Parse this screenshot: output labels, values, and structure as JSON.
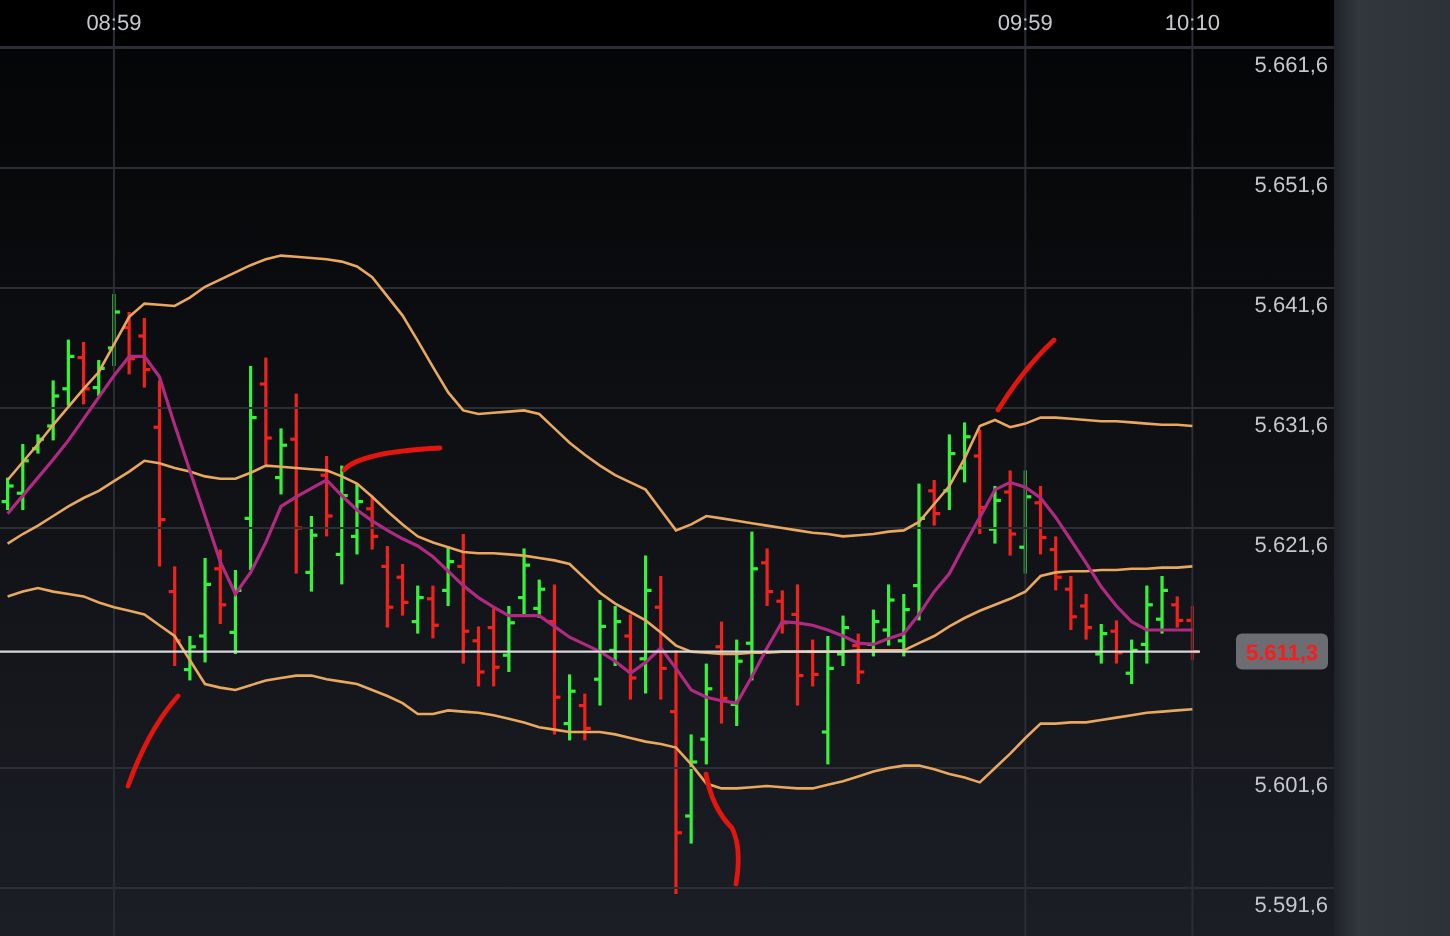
{
  "chart": {
    "chart_data": {
      "type": "line",
      "grid": true,
      "ref_lines": [
        {
          "axis": "y",
          "value": 5611.3,
          "label": "5.611,3"
        }
      ],
      "categories": [
        null,
        null,
        null,
        null,
        null,
        null,
        null,
        "08:59",
        null,
        null,
        null,
        null,
        null,
        null,
        null,
        null,
        null,
        null,
        null,
        null,
        null,
        null,
        null,
        null,
        null,
        null,
        null,
        null,
        null,
        null,
        null,
        null,
        null,
        null,
        null,
        null,
        null,
        null,
        null,
        null,
        null,
        null,
        null,
        null,
        null,
        null,
        null,
        null,
        null,
        null,
        null,
        null,
        null,
        null,
        null,
        null,
        null,
        null,
        null,
        null,
        null,
        null,
        null,
        null,
        null,
        null,
        null,
        "09:59",
        null,
        null,
        null,
        null,
        null,
        null,
        null,
        null,
        null,
        null,
        "10:10"
      ],
      "ylim": [
        5587.6,
        5661.6
      ],
      "yticks": [
        {
          "value": 5661.6,
          "label": "5.661,6"
        },
        {
          "value": 5651.6,
          "label": "5.651,6"
        },
        {
          "value": 5641.6,
          "label": "5.641,6"
        },
        {
          "value": 5631.6,
          "label": "5.631,6"
        },
        {
          "value": 5621.6,
          "label": "5.621,6"
        },
        {
          "value": 5601.6,
          "label": "5.601,6"
        },
        {
          "value": 5591.6,
          "label": "5.591,6"
        }
      ],
      "series": [
        {
          "color": "#e9a85e",
          "values": [
            5625.6,
            5627.1,
            5628.6,
            5630.2,
            5631.7,
            5633.2,
            5634.6,
            5636.9,
            5639.2,
            5640.3,
            5640.2,
            5640.1,
            5640.8,
            5641.7,
            5642.3,
            5642.9,
            5643.5,
            5644.0,
            5644.3,
            5644.2,
            5644.1,
            5644.0,
            5643.8,
            5643.4,
            5642.5,
            5640.9,
            5639.3,
            5637.2,
            5635.0,
            5632.9,
            5631.4,
            5631.1,
            5631.2,
            5631.3,
            5631.4,
            5631.1,
            5629.9,
            5628.7,
            5627.7,
            5626.8,
            5626.0,
            5625.4,
            5624.8,
            5623.1,
            5621.4,
            5621.9,
            5622.6,
            5622.4,
            5622.2,
            5622.0,
            5621.8,
            5621.6,
            5621.4,
            5621.2,
            5621.1,
            5620.9,
            5621.0,
            5621.1,
            5621.3,
            5621.4,
            5622.1,
            5623.6,
            5625.1,
            5627.4,
            5630.1,
            5630.6,
            5630.0,
            5630.3,
            5630.8,
            5630.8,
            5630.7,
            5630.6,
            5630.5,
            5630.5,
            5630.4,
            5630.3,
            5630.2,
            5630.2,
            5630.1
          ]
        },
        {
          "color": "#e9a85e",
          "values": [
            5620.3,
            5621.1,
            5621.8,
            5622.6,
            5623.4,
            5624.1,
            5624.7,
            5625.5,
            5626.3,
            5627.2,
            5627.0,
            5626.6,
            5626.3,
            5625.9,
            5625.7,
            5625.7,
            5626.2,
            5626.8,
            5626.7,
            5626.6,
            5626.5,
            5626.4,
            5625.9,
            5625.3,
            5624.2,
            5623.0,
            5621.9,
            5620.9,
            5620.4,
            5620.0,
            5619.6,
            5619.5,
            5619.5,
            5619.4,
            5619.3,
            5619.1,
            5618.9,
            5618.6,
            5617.4,
            5616.2,
            5615.3,
            5614.6,
            5613.9,
            5612.9,
            5611.8,
            5611.3,
            5611.2,
            5611.1,
            5611.1,
            5611.2,
            5611.2,
            5611.3,
            5611.3,
            5611.3,
            5611.3,
            5611.3,
            5611.4,
            5611.4,
            5611.4,
            5611.4,
            5612.0,
            5612.6,
            5613.4,
            5614.1,
            5614.7,
            5615.2,
            5615.7,
            5616.3,
            5617.6,
            5617.9,
            5618.0,
            5618.0,
            5618.1,
            5618.1,
            5618.2,
            5618.2,
            5618.3,
            5618.3,
            5618.4
          ]
        },
        {
          "color": "#e9a85e",
          "values": [
            5615.9,
            5616.3,
            5616.6,
            5616.3,
            5616.1,
            5615.9,
            5615.4,
            5615.0,
            5614.7,
            5614.4,
            5613.5,
            5612.6,
            5610.6,
            5608.6,
            5608.3,
            5608.1,
            5608.5,
            5608.9,
            5609.1,
            5609.3,
            5609.3,
            5609.0,
            5608.8,
            5608.6,
            5608.1,
            5607.6,
            5607.0,
            5606.1,
            5606.1,
            5606.4,
            5606.3,
            5606.2,
            5606.0,
            5605.7,
            5605.4,
            5605.0,
            5604.8,
            5604.6,
            5604.6,
            5604.6,
            5604.4,
            5604.1,
            5603.8,
            5603.6,
            5603.3,
            5601.9,
            5600.3,
            5599.9,
            5599.9,
            5600.0,
            5600.1,
            5600.0,
            5599.9,
            5599.9,
            5600.2,
            5600.5,
            5600.9,
            5601.3,
            5601.6,
            5601.8,
            5601.8,
            5601.5,
            5601.1,
            5600.8,
            5600.4,
            5601.6,
            5602.8,
            5604.1,
            5605.3,
            5605.3,
            5605.4,
            5605.4,
            5605.6,
            5605.8,
            5606.0,
            5606.2,
            5606.3,
            5606.4,
            5606.5
          ]
        },
        {
          "color": "#b02a82",
          "values": [
            5622.8,
            5624.3,
            5625.8,
            5627.3,
            5628.9,
            5630.7,
            5632.5,
            5634.3,
            5635.9,
            5635.9,
            5634.2,
            5630.2,
            5626.4,
            5622.6,
            5618.8,
            5616.1,
            5617.9,
            5620.4,
            5623.4,
            5624.2,
            5624.9,
            5625.6,
            5624.3,
            5623.1,
            5622.2,
            5621.4,
            5620.7,
            5620.1,
            5619.2,
            5618.0,
            5616.8,
            5615.8,
            5615.0,
            5614.3,
            5614.3,
            5614.3,
            5613.4,
            5612.5,
            5611.9,
            5611.3,
            5610.5,
            5609.5,
            5610.4,
            5611.6,
            5609.9,
            5608.1,
            5607.5,
            5607.2,
            5607.0,
            5609.2,
            5611.6,
            5613.8,
            5613.7,
            5613.5,
            5613.1,
            5612.6,
            5612.0,
            5611.9,
            5612.4,
            5612.8,
            5614.4,
            5616.3,
            5617.8,
            5620.2,
            5622.5,
            5624.8,
            5625.4,
            5625.0,
            5624.1,
            5622.5,
            5620.6,
            5618.7,
            5616.7,
            5615.1,
            5613.8,
            5613.1,
            5613.1,
            5613.1,
            5613.1
          ]
        }
      ]
    }
  }
}
